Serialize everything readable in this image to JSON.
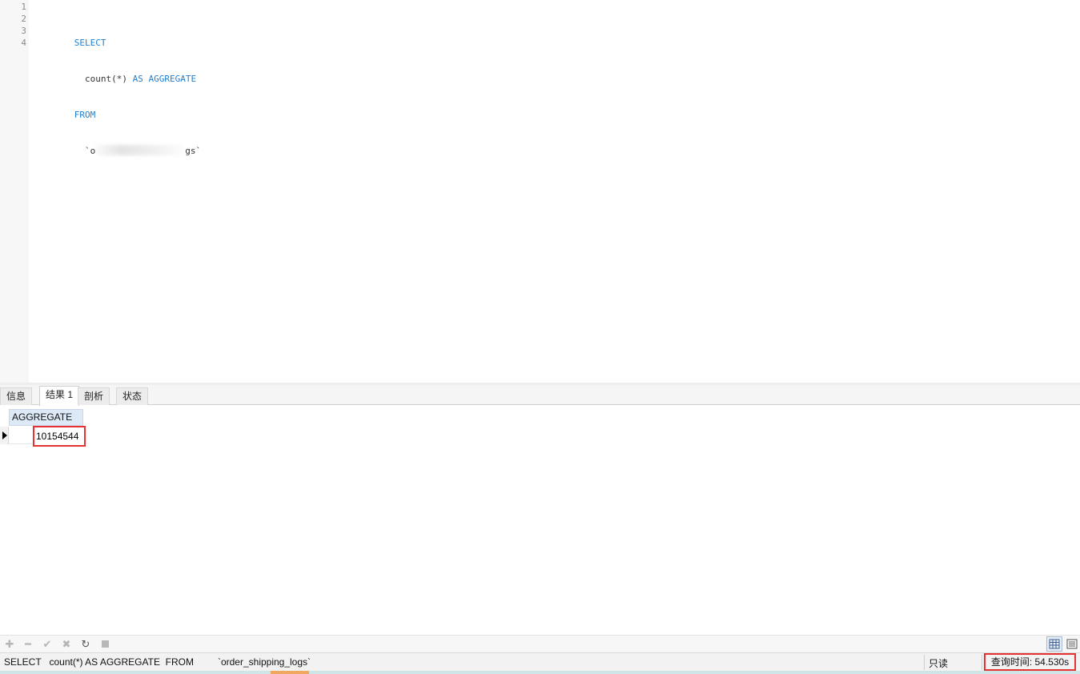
{
  "editor": {
    "line_numbers": [
      "1",
      "2",
      "3",
      "4"
    ],
    "lines": [
      {
        "parts": [
          {
            "text": "SELECT",
            "kw": true
          }
        ]
      },
      {
        "parts": [
          {
            "text": "  count(*) ",
            "kw": false
          },
          {
            "text": "AS AGGREGATE",
            "kw": true
          }
        ]
      },
      {
        "parts": [
          {
            "text": "FROM",
            "kw": true
          }
        ]
      },
      {
        "parts": [
          {
            "text": "  `o",
            "kw": false
          },
          {
            "text": "",
            "blur": true
          },
          {
            "text": "gs`",
            "kw": false
          }
        ]
      }
    ]
  },
  "tabs": [
    {
      "label": "信息",
      "active": false
    },
    {
      "label": "结果 1",
      "active": true
    },
    {
      "label": "剖析",
      "active": false
    },
    {
      "label": "状态",
      "active": false
    }
  ],
  "grid": {
    "column_header": "AGGREGATE",
    "value": "10154544"
  },
  "status": {
    "sql": "SELECT   count(*) AS AGGREGATE  FROM         `order_shipping_logs`",
    "readonly": "只读",
    "query_time": "查询时间: 54.530s"
  },
  "colors": {
    "keyword": "#1f7fd0",
    "highlight_box": "#e53333",
    "grid_header": "#dde9f7"
  }
}
